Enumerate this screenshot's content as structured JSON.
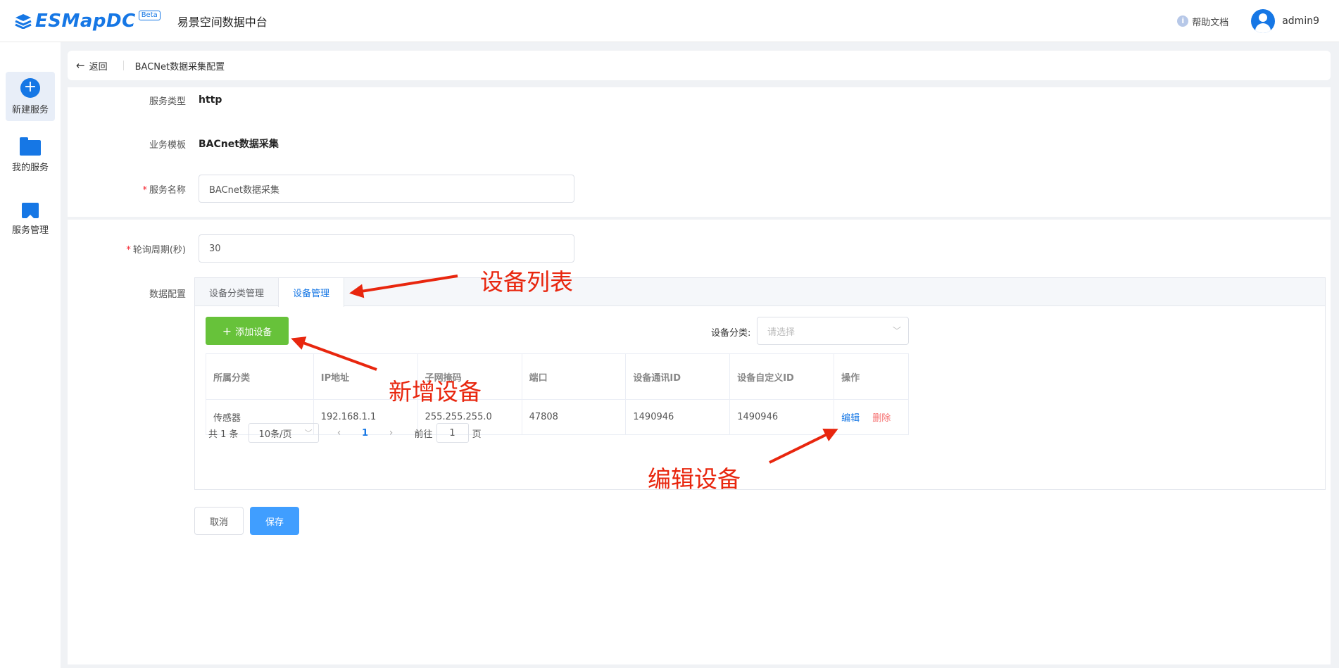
{
  "header": {
    "brand": "ESMapDC",
    "beta": "Beta",
    "app_title": "易景空间数据中台",
    "help": "帮助文档",
    "username": "admin9"
  },
  "sidebar": {
    "items": [
      {
        "label": "新建服务",
        "icon": "plus-circle-icon",
        "active": true
      },
      {
        "label": "我的服务",
        "icon": "folder-icon"
      },
      {
        "label": "服务管理",
        "icon": "bookmark-icon"
      }
    ]
  },
  "breadcrumb": {
    "back": "返回",
    "title": "BACNet数据采集配置"
  },
  "form": {
    "service_type_label": "服务类型",
    "service_type_value": "http",
    "template_label": "业务模板",
    "template_value": "BACnet数据采集",
    "service_name_label": "服务名称",
    "service_name_value": "BACnet数据采集",
    "poll_label": "轮询周期(秒)",
    "poll_value": "30",
    "data_config_label": "数据配置",
    "required_mark": "*"
  },
  "tabs": [
    {
      "label": "设备分类管理",
      "active": false
    },
    {
      "label": "设备管理",
      "active": true
    }
  ],
  "device": {
    "add_button": "添加设备",
    "category_label": "设备分类:",
    "category_placeholder": "请选择",
    "columns": [
      "所属分类",
      "IP地址",
      "子网掩码",
      "端口",
      "设备通讯ID",
      "设备自定义ID",
      "操作"
    ],
    "rows": [
      {
        "category": "传感器",
        "ip": "192.168.1.1",
        "mask": "255.255.255.0",
        "port": "47808",
        "comm_id": "1490946",
        "custom_id": "1490946",
        "edit": "编辑",
        "delete": "删除"
      }
    ]
  },
  "pager": {
    "total": "共 1 条",
    "page_size": "10条/页",
    "current_page": "1",
    "goto_label": "前往",
    "goto_value": "1",
    "page_suffix": "页"
  },
  "actions": {
    "cancel": "取消",
    "save": "保存"
  },
  "annotations": {
    "device_list": "设备列表",
    "add_device": "新增设备",
    "edit_device": "编辑设备"
  },
  "colors": {
    "primary": "#1677e5",
    "success": "#67c23a",
    "danger": "#f56c6c",
    "annotation": "#e8260e"
  }
}
